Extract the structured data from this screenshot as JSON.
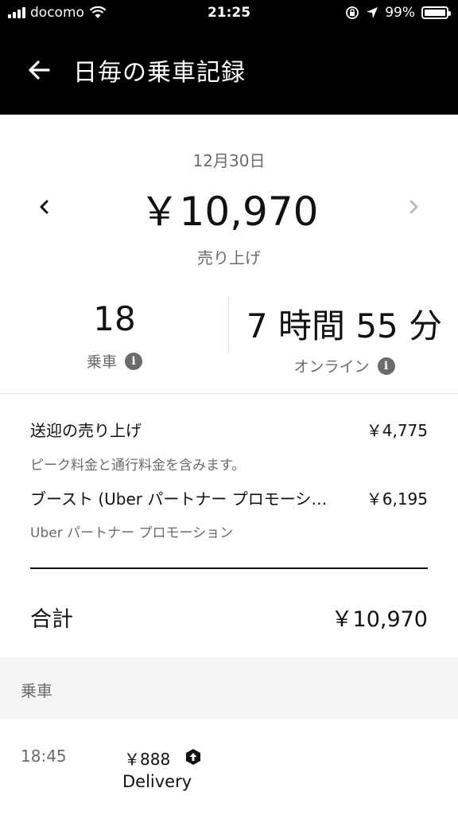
{
  "status_bar": {
    "carrier": "docomo",
    "time": "21:25",
    "battery": "99%",
    "icons": [
      "signal-icon",
      "wifi-icon",
      "orientation-lock-icon",
      "location-arrow-icon",
      "battery-icon"
    ]
  },
  "header": {
    "title": "日毎の乗車記録",
    "back_icon": "arrow-left-icon"
  },
  "summary": {
    "date": "12月30日",
    "total": "￥10,970",
    "total_label": "売り上げ",
    "prev_icon": "chevron-left-icon",
    "next_icon": "chevron-right-icon"
  },
  "stats": {
    "rides_value": "18",
    "rides_label": "乗車",
    "online_value": "7 時間 55 分",
    "online_label": "オンライン",
    "info_icon": "info-icon"
  },
  "breakdown": {
    "items": [
      {
        "label": "送迎の売り上げ",
        "value": "￥4,775",
        "note": "ピーク料金と通行料金を含みます。"
      },
      {
        "label": "ブースト (Uber パートナー プロモーシ…",
        "value": "￥6,195",
        "note": "Uber パートナー プロモーション"
      }
    ],
    "total_label": "合計",
    "total_value": "￥10,970"
  },
  "trips": {
    "section_title": "乗車",
    "items": [
      {
        "time": "18:45",
        "fare": "￥888",
        "type": "Delivery",
        "icon": "boost-icon"
      }
    ]
  },
  "colors": {
    "header_bg": "#000000",
    "text_primary": "#111111",
    "text_secondary": "#6b6b6b",
    "section_bg": "#f4f4f4"
  }
}
